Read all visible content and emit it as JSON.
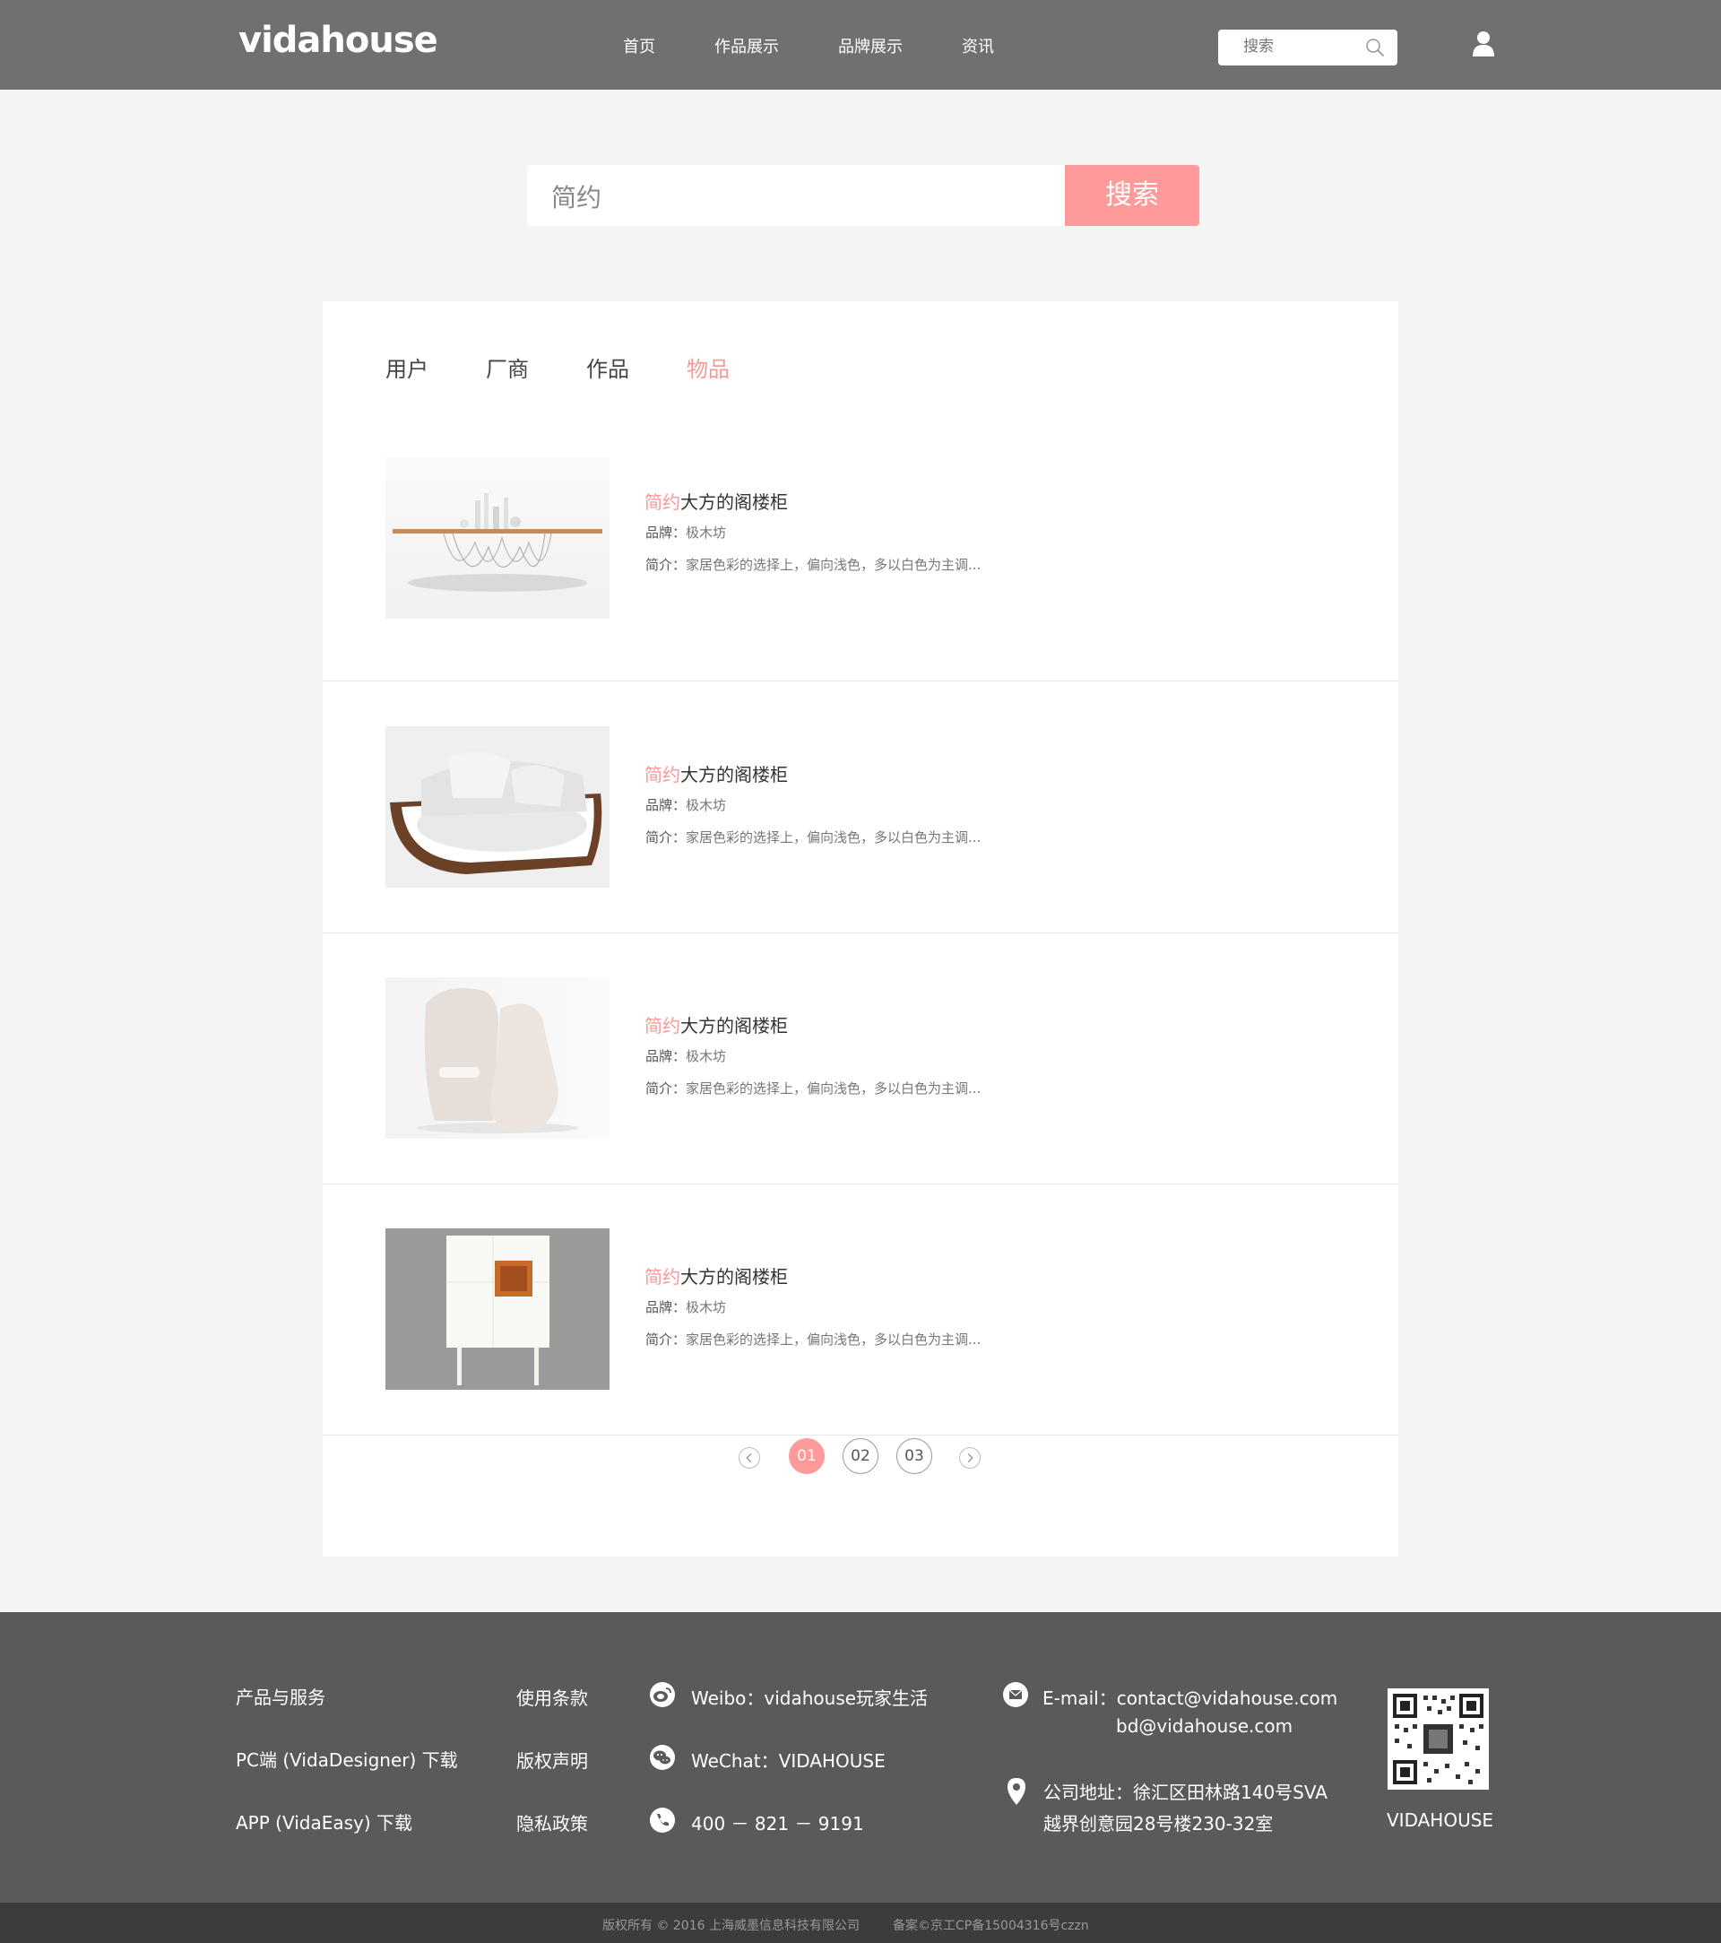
{
  "header": {
    "logo": "vidahouse",
    "nav": [
      "首页",
      "作品展示",
      "品牌展示",
      "资讯"
    ],
    "search_placeholder": "搜索"
  },
  "search": {
    "query": "简约",
    "button": "搜索"
  },
  "tabs": [
    {
      "label": "用户",
      "active": false
    },
    {
      "label": "厂商",
      "active": false
    },
    {
      "label": "作品",
      "active": false
    },
    {
      "label": "物品",
      "active": true
    }
  ],
  "results": [
    {
      "highlight": "简约",
      "title": "大方的阁楼柜",
      "brand_label": "品牌：",
      "brand": "极木坊",
      "desc_label": "简介：",
      "desc": "家居色彩的选择上，偏向浅色，多以白色为主调..."
    },
    {
      "highlight": "简约",
      "title": "大方的阁楼柜",
      "brand_label": "品牌：",
      "brand": "极木坊",
      "desc_label": "简介：",
      "desc": "家居色彩的选择上，偏向浅色，多以白色为主调..."
    },
    {
      "highlight": "简约",
      "title": "大方的阁楼柜",
      "brand_label": "品牌：",
      "brand": "极木坊",
      "desc_label": "简介：",
      "desc": "家居色彩的选择上，偏向浅色，多以白色为主调..."
    },
    {
      "highlight": "简约",
      "title": "大方的阁楼柜",
      "brand_label": "品牌：",
      "brand": "极木坊",
      "desc_label": "简介：",
      "desc": "家居色彩的选择上，偏向浅色，多以白色为主调..."
    }
  ],
  "pagination": {
    "pages": [
      "01",
      "02",
      "03"
    ],
    "current": "01"
  },
  "footer": {
    "col1": [
      "产品与服务",
      "PC端 (VidaDesigner) 下载",
      "APP (VidaEasy) 下载"
    ],
    "col2": [
      "使用条款",
      "版权声明",
      "隐私政策"
    ],
    "weibo": "Weibo：vidahouse玩家生活",
    "wechat": "WeChat：VIDAHOUSE",
    "phone": "400 － 821 － 9191",
    "email_line1": "E-mail：contact@vidahouse.com",
    "email_line2": "bd@vidahouse.com",
    "address_line1": "公司地址：徐汇区田林路140号SVA",
    "address_line2": "越界创意园28号楼230-32室",
    "qr_caption": "VIDAHOUSE"
  },
  "copyright": {
    "left": "版权所有 © 2016 上海威墨信息科技有限公司",
    "right": "备案©京工CP备15004316号czzn"
  },
  "colors": {
    "accent": "#ff9a9a",
    "header_bg": "#707070",
    "footer_bg": "#5a5a5a",
    "copyright_bg": "#3c3c3c"
  }
}
